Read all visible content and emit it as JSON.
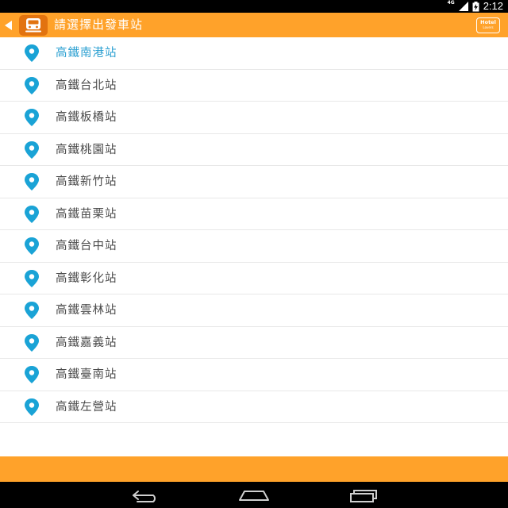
{
  "status_bar": {
    "network_label": "4G",
    "time": "2:12",
    "wifi_icon": "wifi-icon",
    "signal_icon": "signal-icon",
    "battery_icon": "battery-charging-icon"
  },
  "action_bar": {
    "title": "請選擇出發車站",
    "back_icon": "back-arrow-icon",
    "app_icon": "train-icon",
    "hotel_button_label": "Hotel",
    "hotel_button_sub": "Lovers"
  },
  "stations": [
    {
      "name": "高鐵南港站",
      "selected": true
    },
    {
      "name": "高鐵台北站",
      "selected": false
    },
    {
      "name": "高鐵板橋站",
      "selected": false
    },
    {
      "name": "高鐵桃園站",
      "selected": false
    },
    {
      "name": "高鐵新竹站",
      "selected": false
    },
    {
      "name": "高鐵苗栗站",
      "selected": false
    },
    {
      "name": "高鐵台中站",
      "selected": false
    },
    {
      "name": "高鐵彰化站",
      "selected": false
    },
    {
      "name": "高鐵雲林站",
      "selected": false
    },
    {
      "name": "高鐵嘉義站",
      "selected": false
    },
    {
      "name": "高鐵臺南站",
      "selected": false
    },
    {
      "name": "高鐵左營站",
      "selected": false
    }
  ],
  "nav_bar": {
    "back_icon": "nav-back-icon",
    "home_icon": "nav-home-icon",
    "recents_icon": "nav-recents-icon"
  },
  "colors": {
    "accent": "#ffa22a",
    "pin": "#1aa3d6",
    "selected_text": "#2a9fd1",
    "text": "#4a4a4a",
    "app_icon_bg": "#e2730f"
  }
}
